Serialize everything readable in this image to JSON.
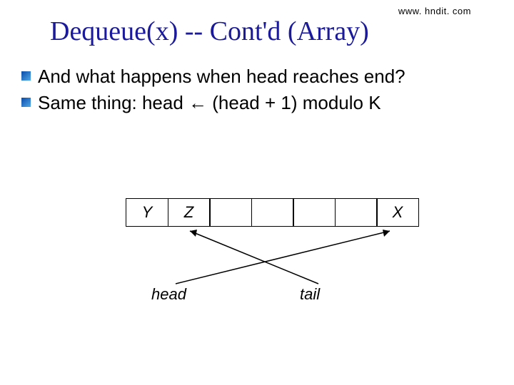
{
  "url": "www. hndit. com",
  "title": "Dequeue(x)  -- Cont'd      (Array)",
  "bullets": [
    "And what happens when head reaches end?",
    "Same thing: head ← (head + 1) modulo K"
  ],
  "cells": [
    "Y",
    "Z",
    "",
    "",
    "",
    "",
    "X"
  ],
  "labels": {
    "head": "head",
    "tail": "tail"
  }
}
